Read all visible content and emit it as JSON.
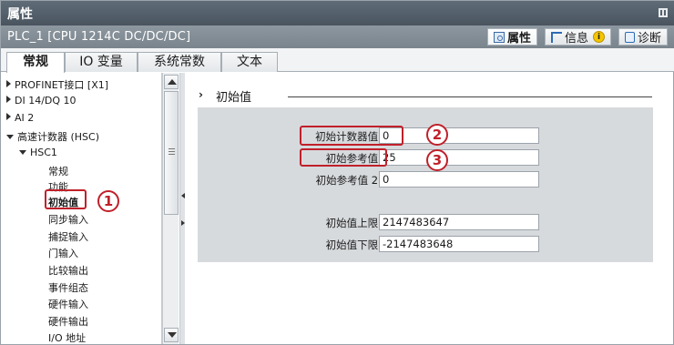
{
  "window": {
    "title": "属性"
  },
  "object": {
    "name": "PLC_1 [CPU 1214C DC/DC/DC]"
  },
  "inspector_tabs": {
    "properties": "属性",
    "info": "信息",
    "info_badge": "i",
    "diagnostics": "诊断"
  },
  "tabs": [
    "常规",
    "IO 变量",
    "系统常数",
    "文本"
  ],
  "tree": {
    "items": [
      {
        "label": "PROFINET接口 [X1]"
      },
      {
        "label": "DI 14/DQ 10"
      },
      {
        "label": "AI 2"
      },
      {
        "label": "高速计数器 (HSC)"
      },
      {
        "label": "HSC1"
      },
      {
        "label": "常规"
      },
      {
        "label": "功能"
      },
      {
        "label": "初始值"
      },
      {
        "label": "同步输入"
      },
      {
        "label": "捕捉输入"
      },
      {
        "label": "门输入"
      },
      {
        "label": "比较输出"
      },
      {
        "label": "事件组态"
      },
      {
        "label": "硬件输入"
      },
      {
        "label": "硬件输出"
      },
      {
        "label": "I/O 地址"
      }
    ],
    "selected": "初始值"
  },
  "annotations": [
    "1",
    "2",
    "3"
  ],
  "section": {
    "chevron": "›",
    "title": "初始值",
    "fields": [
      {
        "label": "初始计数器值:",
        "value": "0"
      },
      {
        "label": "初始参考值:",
        "value": "25"
      },
      {
        "label": "初始参考值 2:",
        "value": "0"
      },
      {
        "label": "初始值上限:",
        "value": "2147483647"
      },
      {
        "label": "初始值下限:",
        "value": "-2147483648"
      }
    ]
  },
  "colors": {
    "title_bar": "#4f5b66",
    "object_bar": "#848e97",
    "panel": "#d7dadd",
    "annotation": "#c0202a"
  }
}
